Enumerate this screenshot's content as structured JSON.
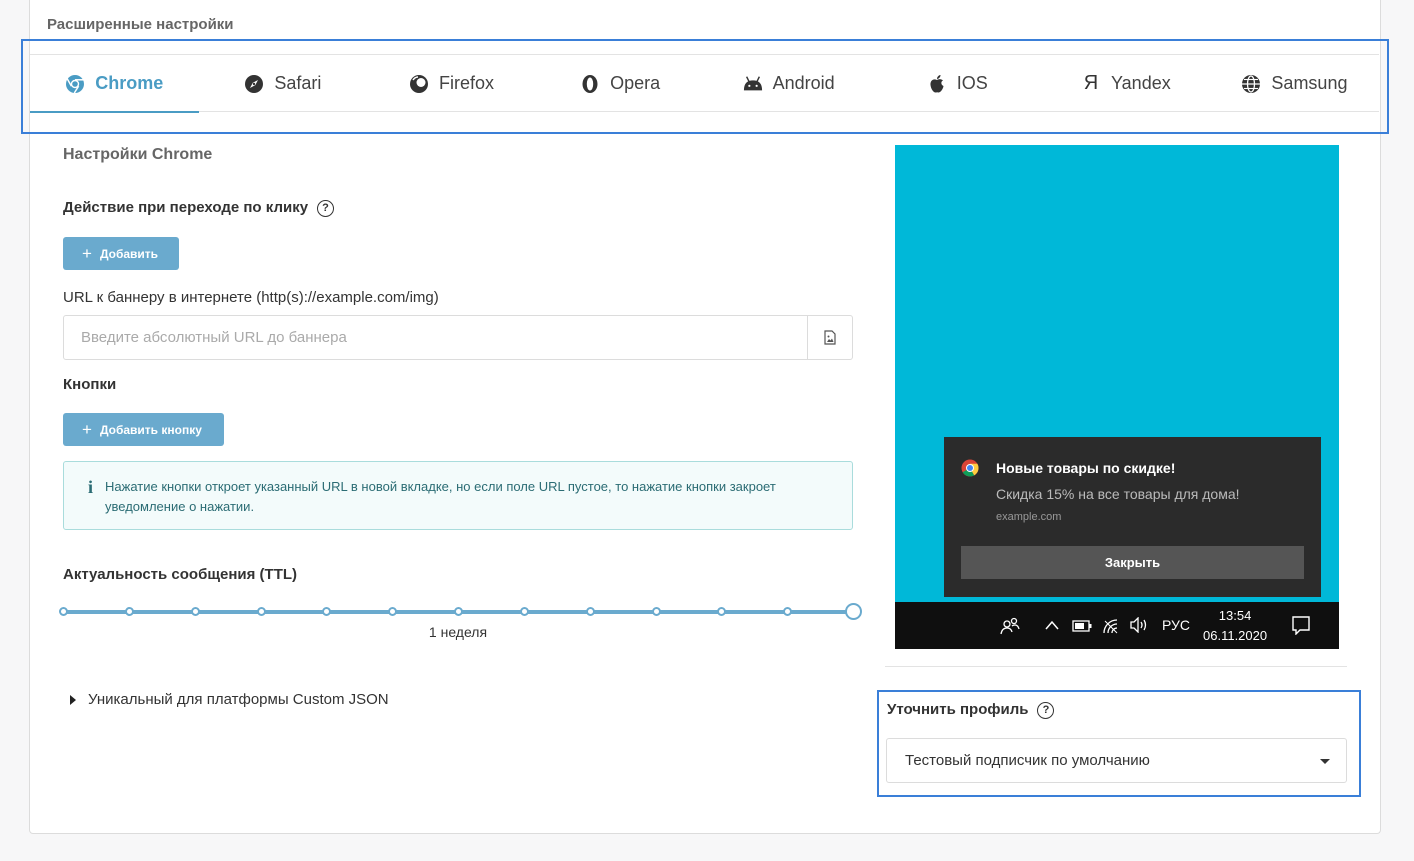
{
  "section_title": "Расширенные настройки",
  "tabs": [
    {
      "label": "Chrome",
      "icon": "chrome-icon",
      "active": true
    },
    {
      "label": "Safari",
      "icon": "compass-icon",
      "active": false
    },
    {
      "label": "Firefox",
      "icon": "firefox-icon",
      "active": false
    },
    {
      "label": "Opera",
      "icon": "opera-icon",
      "active": false
    },
    {
      "label": "Android",
      "icon": "android-icon",
      "active": false
    },
    {
      "label": "IOS",
      "icon": "apple-icon",
      "active": false
    },
    {
      "label": "Yandex",
      "icon": "yandex-icon",
      "active": false
    },
    {
      "label": "Samsung",
      "icon": "globe-icon",
      "active": false
    }
  ],
  "settings": {
    "title": "Настройки Chrome",
    "click_action_label": "Действие при переходе по клику",
    "add_label": "Добавить",
    "banner_url_label": "URL к баннеру в интернете (http(s)://example.com/img)",
    "banner_url_placeholder": "Введите абсолютный URL до баннера",
    "banner_url_value": "",
    "buttons_label": "Кнопки",
    "add_button_label": "Добавить кнопку",
    "info_icon": "i",
    "info_text": "Нажатие кнопки откроет указанный URL в новой вкладке, но если поле URL пустое, то нажатие кнопки закроет уведомление о нажатии.",
    "ttl_label": "Актуальность сообщения (TTL)",
    "ttl_value": "1 неделя",
    "ttl_steps": 12,
    "ttl_selected_index": 11,
    "custom_json_label": "Уникальный для платформы Custom JSON"
  },
  "preview": {
    "background_color": "#00b8d8",
    "notification_title": "Новые товары по скидке!",
    "notification_body": "Скидка 15% на все товары для дома!",
    "notification_site": "example.com",
    "notification_button": "Закрыть",
    "taskbar_lang": "РУС",
    "taskbar_time": "13:54",
    "taskbar_date": "06.11.2020"
  },
  "profile": {
    "label": "Уточнить профиль",
    "selected": "Тестовый подписчик по умолчанию"
  },
  "colors": {
    "accent": "#4a9cc4",
    "button": "#6aaace",
    "highlight": "#3a7fd8"
  }
}
